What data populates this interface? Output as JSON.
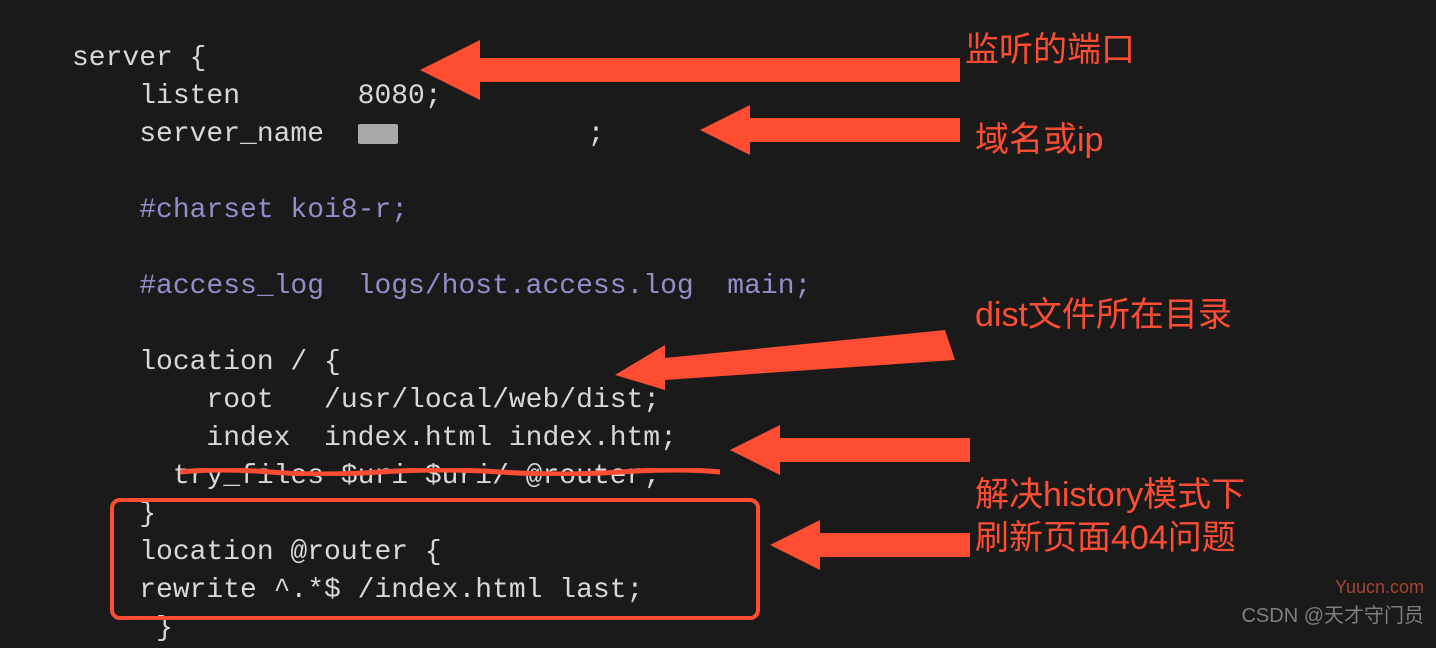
{
  "code": {
    "l1": "server {",
    "l2": "    listen       8080;",
    "l3a": "    server_name  ",
    "l3b": ";",
    "l4": "",
    "l5": "    #charset koi8-r;",
    "l6": "",
    "l7": "    #access_log  logs/host.access.log  main;",
    "l8": "",
    "l9": "    location / {",
    "l10": "        root   /usr/local/web/dist;",
    "l11": "        index  index.html index.htm;",
    "l12": "      try_files $uri $uri/ @router;",
    "l13": "    }",
    "l14": "    location @router {",
    "l15": "    rewrite ^.*$ /index.html last;",
    "l16": "     }"
  },
  "labels": {
    "listen": "监听的端口",
    "server_name": "域名或ip",
    "root": "dist文件所在目录",
    "router1": "解决history模式下",
    "router2": "刷新页面404问题"
  },
  "watermark": {
    "site": "Yuucn.com",
    "credit": "CSDN @天才守门员"
  }
}
